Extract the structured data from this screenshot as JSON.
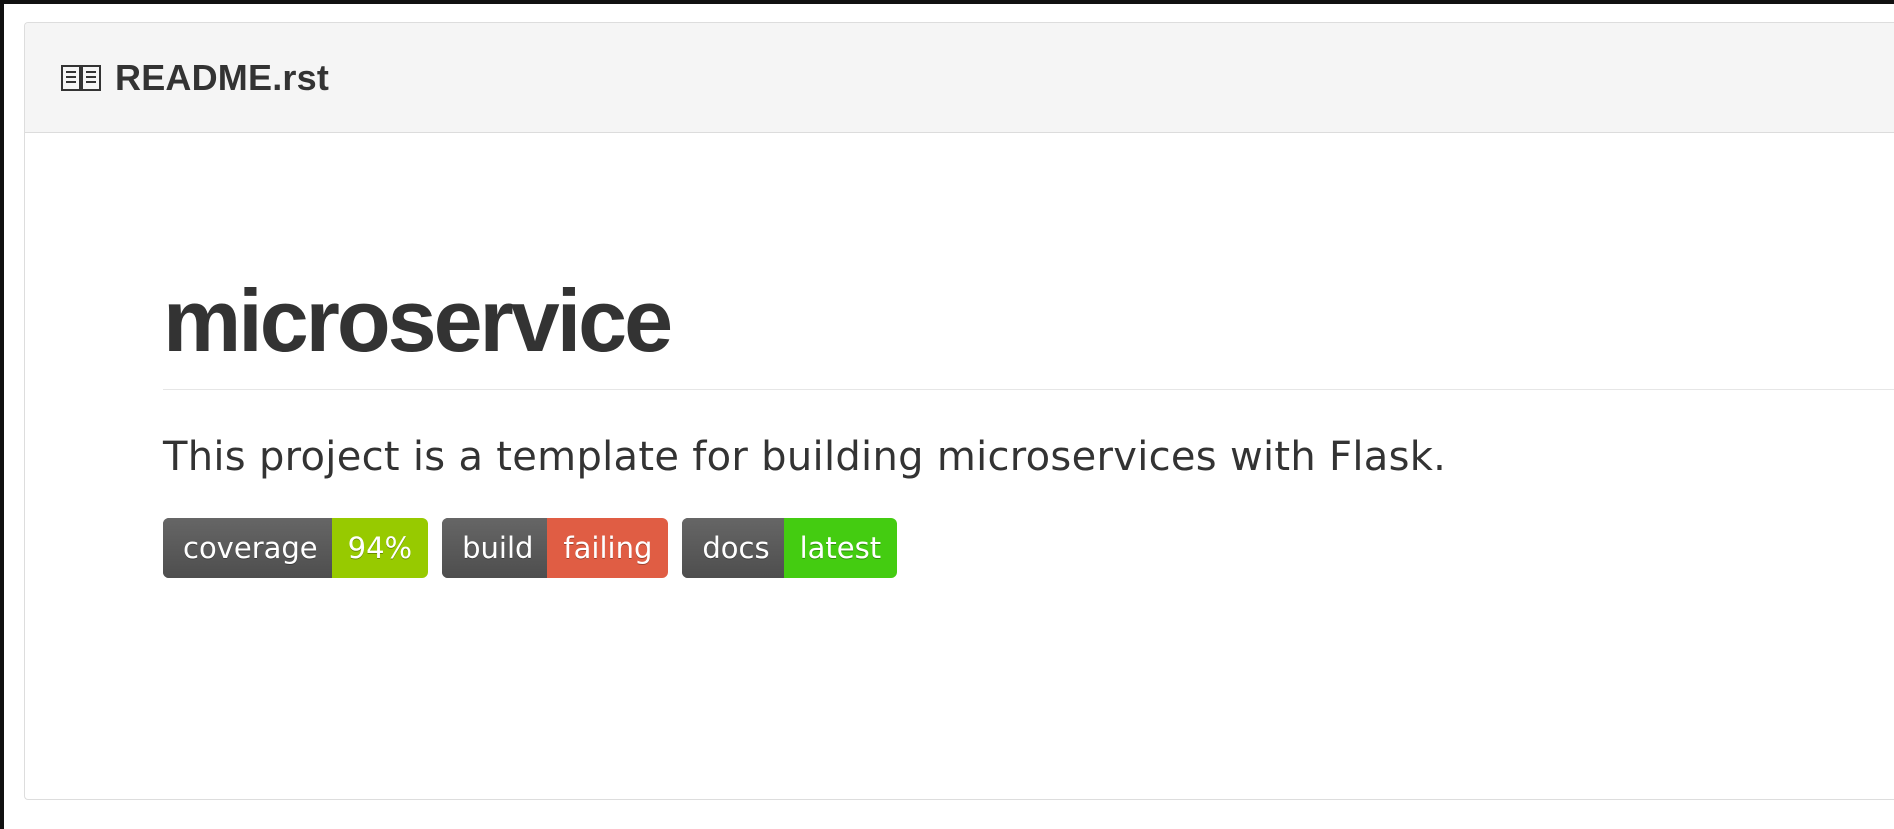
{
  "readme": {
    "icon": "book-icon",
    "filename": "README.rst"
  },
  "content": {
    "title": "microservice",
    "description": "This project is a template for building microservices with Flask."
  },
  "badges": [
    {
      "label": "coverage",
      "value": "94%",
      "color": "#97ca00"
    },
    {
      "label": "build",
      "value": "failing",
      "color": "#e05d44"
    },
    {
      "label": "docs",
      "value": "latest",
      "color": "#4c1"
    }
  ],
  "colors": {
    "header_bg": "#f5f5f5",
    "text": "#333333",
    "badge_left": "#555555"
  }
}
